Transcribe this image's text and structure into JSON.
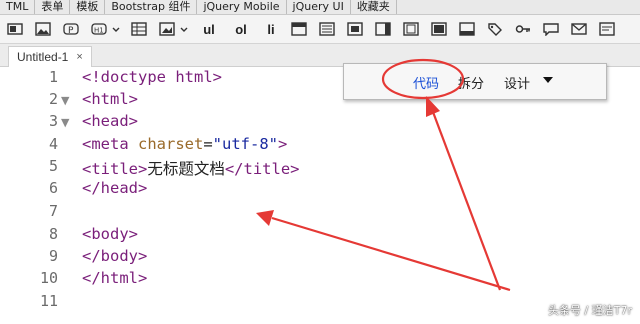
{
  "categories": [
    "TML",
    "表单",
    "模板",
    "Bootstrap 组件",
    "jQuery Mobile",
    "jQuery UI",
    "收藏夹"
  ],
  "toolbar": {
    "ul_label": "ul",
    "ol_label": "ol",
    "li_label": "li",
    "icons": [
      "image-icon",
      "paragraph-icon",
      "heading-icon",
      "table-icon",
      "media-icon",
      "list-ul",
      "list-ol",
      "list-li"
    ]
  },
  "document": {
    "tab_label": "Untitled-1",
    "close_label": "×"
  },
  "editor": {
    "line_numbers": [
      "1",
      "2",
      "3",
      "4",
      "5",
      "6",
      "7",
      "8",
      "9",
      "10",
      "11"
    ],
    "lines": {
      "l1": "<!doctype html>",
      "l2": "<html>",
      "l3": "<head>",
      "l4_tag_open": "<meta ",
      "l4_attr": "charset",
      "l4_eq": "=",
      "l4_val": "\"utf-8\"",
      "l4_close": ">",
      "l5_open": "<title>",
      "l5_text": "无标题文档",
      "l5_close": "</title>",
      "l6": "</head>",
      "l8": "<body>",
      "l9": "</body>",
      "l10": "</html>"
    }
  },
  "view_switcher": {
    "code": "代码",
    "split": "拆分",
    "design": "设计"
  },
  "watermark": "头条号 / 瑾洁T7r",
  "colors": {
    "annotation_red": "#e53935",
    "active_view": "#1a4fd6"
  }
}
